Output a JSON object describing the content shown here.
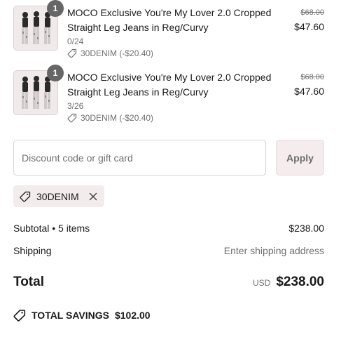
{
  "line_items": [
    {
      "quantity": "1",
      "title": "MOCO Exclusive You're My Lover 2.0 Cropped Straight Leg Jeans in Reg/Curvy",
      "variant": "0/24",
      "discount": "30DENIM (-$20.40)",
      "original_price": "$68.00",
      "price": "$47.60"
    },
    {
      "quantity": "1",
      "title": "MOCO Exclusive You're My Lover 2.0 Cropped Straight Leg Jeans in Reg/Curvy",
      "variant": "3/26",
      "discount": "30DENIM (-$20.40)",
      "original_price": "$68.00",
      "price": "$47.60"
    }
  ],
  "discount_form": {
    "placeholder": "Discount code or gift card",
    "apply_label": "Apply"
  },
  "applied_code": "30DENIM",
  "summary": {
    "subtotal_label": "Subtotal • 5 items",
    "subtotal_value": "$238.00",
    "shipping_label": "Shipping",
    "shipping_value": "Enter shipping address",
    "total_label": "Total",
    "currency": "USD",
    "total_value": "$238.00"
  },
  "savings": {
    "label": "TOTAL SAVINGS",
    "amount": "$102.00"
  },
  "colors": {
    "badge": "#666666",
    "tag_bg": "#f3ecec",
    "apply_bg": "#f5eded"
  }
}
